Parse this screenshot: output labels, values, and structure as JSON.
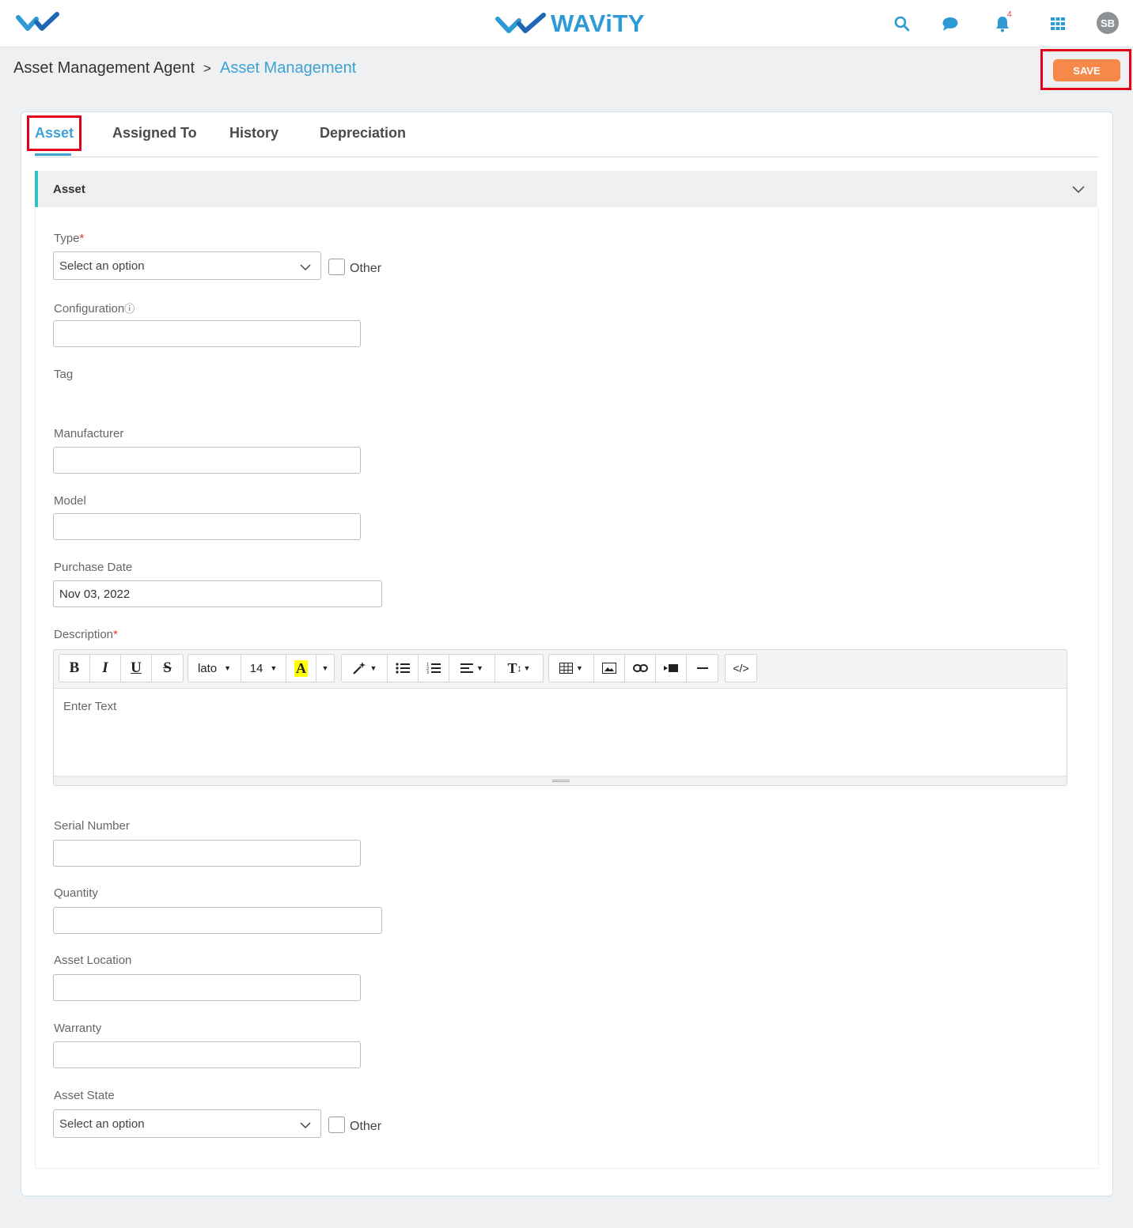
{
  "header": {
    "brand": "WAViTY",
    "notifications_count": "4",
    "user_initials": "SB",
    "brand_color": "#2d9ad6"
  },
  "breadcrumb": {
    "root": "Asset Management Agent",
    "separator": ">",
    "current": "Asset Management"
  },
  "actions": {
    "save_label": "SAVE",
    "save_color": "#f7884a"
  },
  "tabs": [
    {
      "label": "Asset",
      "active": true
    },
    {
      "label": "Assigned To",
      "active": false
    },
    {
      "label": "History",
      "active": false
    },
    {
      "label": "Depreciation",
      "active": false
    }
  ],
  "section": {
    "title": "Asset",
    "accent": "#2cc4c4"
  },
  "form": {
    "type": {
      "label": "Type",
      "required": "*",
      "value": "Select an option",
      "other_label": "Other"
    },
    "configuration": {
      "label": "Configuration",
      "info_icon": "ⓘ",
      "value": ""
    },
    "tag": {
      "label": "Tag"
    },
    "manufacturer": {
      "label": "Manufacturer",
      "value": ""
    },
    "model": {
      "label": "Model",
      "value": ""
    },
    "purchase_date": {
      "label": "Purchase Date",
      "value": "Nov 03, 2022"
    },
    "description": {
      "label": "Description",
      "required": "*",
      "placeholder": "Enter Text",
      "toolbar": {
        "font": "lato",
        "size": "14",
        "bold": "B",
        "italic": "I",
        "underline": "U",
        "strike": "S",
        "color": "A",
        "style": "T",
        "code": "</>"
      }
    },
    "serial_number": {
      "label": "Serial Number",
      "value": ""
    },
    "quantity": {
      "label": "Quantity",
      "value": ""
    },
    "asset_location": {
      "label": "Asset Location",
      "value": ""
    },
    "warranty": {
      "label": "Warranty",
      "value": ""
    },
    "asset_state": {
      "label": "Asset State",
      "value": "Select an option",
      "other_label": "Other"
    }
  }
}
